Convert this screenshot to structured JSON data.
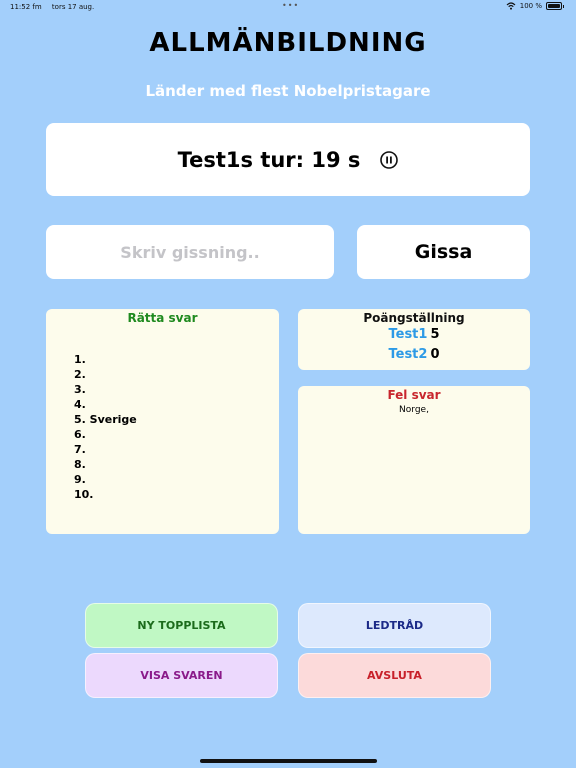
{
  "status_bar": {
    "time": "11:52 fm",
    "date": "tors 17 aug.",
    "battery": "100 %",
    "dots": "•••"
  },
  "header": {
    "title": "ALLMÄNBILDNING",
    "subtitle": "Länder med flest Nobelpristagare"
  },
  "turn": {
    "text": "Test1s tur:  19 s"
  },
  "guess": {
    "placeholder": "Skriv gissning..",
    "value": "",
    "button_label": "Gissa"
  },
  "correct_answers": {
    "title": "Rätta svar",
    "items": [
      "1.",
      "2.",
      "3.",
      "4.",
      "5. Sverige",
      "6.",
      "7.",
      "8.",
      "9.",
      "10."
    ]
  },
  "scoreboard": {
    "title": "Poängställning",
    "players": [
      {
        "name": "Test1",
        "score": "5"
      },
      {
        "name": "Test2",
        "score": "0"
      }
    ]
  },
  "wrong_answers": {
    "title": "Fel svar",
    "text": "Norge,"
  },
  "buttons": {
    "new_toplist": "NY TOPPLISTA",
    "hint": "LEDTRÅD",
    "show_answers": "VISA SVAREN",
    "quit": "AVSLUTA"
  },
  "colors": {
    "background": "#a3cffb",
    "correct": "#1f8a1f",
    "wrong": "#c8262d",
    "player": "#2d9ae6"
  },
  "icons": {
    "pause": "pause-circle-icon",
    "wifi": "wifi-icon",
    "battery": "battery-icon"
  }
}
